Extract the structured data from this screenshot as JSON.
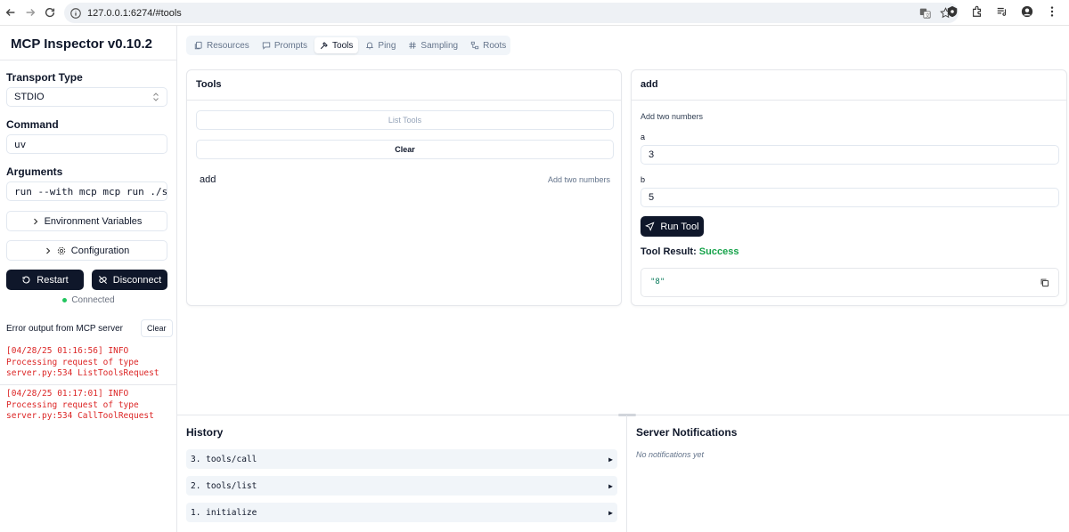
{
  "browser": {
    "url": "127.0.0.1:6274/#tools"
  },
  "sidebar": {
    "title": "MCP Inspector v0.10.2",
    "transport_label": "Transport Type",
    "transport_value": "STDIO",
    "command_label": "Command",
    "command_value": "uv",
    "arguments_label": "Arguments",
    "arguments_value": "run --with mcp mcp run ./server",
    "env_button": "Environment Variables",
    "config_button": "Configuration",
    "restart_button": "Restart",
    "disconnect_button": "Disconnect",
    "status_text": "Connected",
    "error_title": "Error output from MCP server",
    "clear_button": "Clear",
    "logs": [
      "[04/28/25 01:16:56] INFO\nProcessing request of type\nserver.py:534 ListToolsRequest",
      "[04/28/25 01:17:01] INFO\nProcessing request of type\nserver.py:534 CallToolRequest"
    ]
  },
  "tabs": [
    {
      "label": "Resources",
      "icon": "files-icon"
    },
    {
      "label": "Prompts",
      "icon": "message-icon"
    },
    {
      "label": "Tools",
      "icon": "hammer-icon",
      "active": true
    },
    {
      "label": "Ping",
      "icon": "bell-icon"
    },
    {
      "label": "Sampling",
      "icon": "hash-icon"
    },
    {
      "label": "Roots",
      "icon": "tree-icon"
    }
  ],
  "tools_panel": {
    "title": "Tools",
    "list_button": "List Tools",
    "clear_button": "Clear",
    "tool_name": "add",
    "tool_desc": "Add two numbers"
  },
  "tool_detail": {
    "title": "add",
    "description": "Add two numbers",
    "param_a_label": "a",
    "param_a_value": "3",
    "param_b_label": "b",
    "param_b_value": "5",
    "run_button": "Run Tool",
    "result_label": "Tool Result:",
    "result_status": "Success",
    "result_value": "\"8\"",
    "success_color": "#16a34a"
  },
  "history": {
    "title": "History",
    "items": [
      "3. tools/call",
      "2. tools/list",
      "1. initialize"
    ]
  },
  "notifications": {
    "title": "Server Notifications",
    "empty_text": "No notifications yet"
  }
}
